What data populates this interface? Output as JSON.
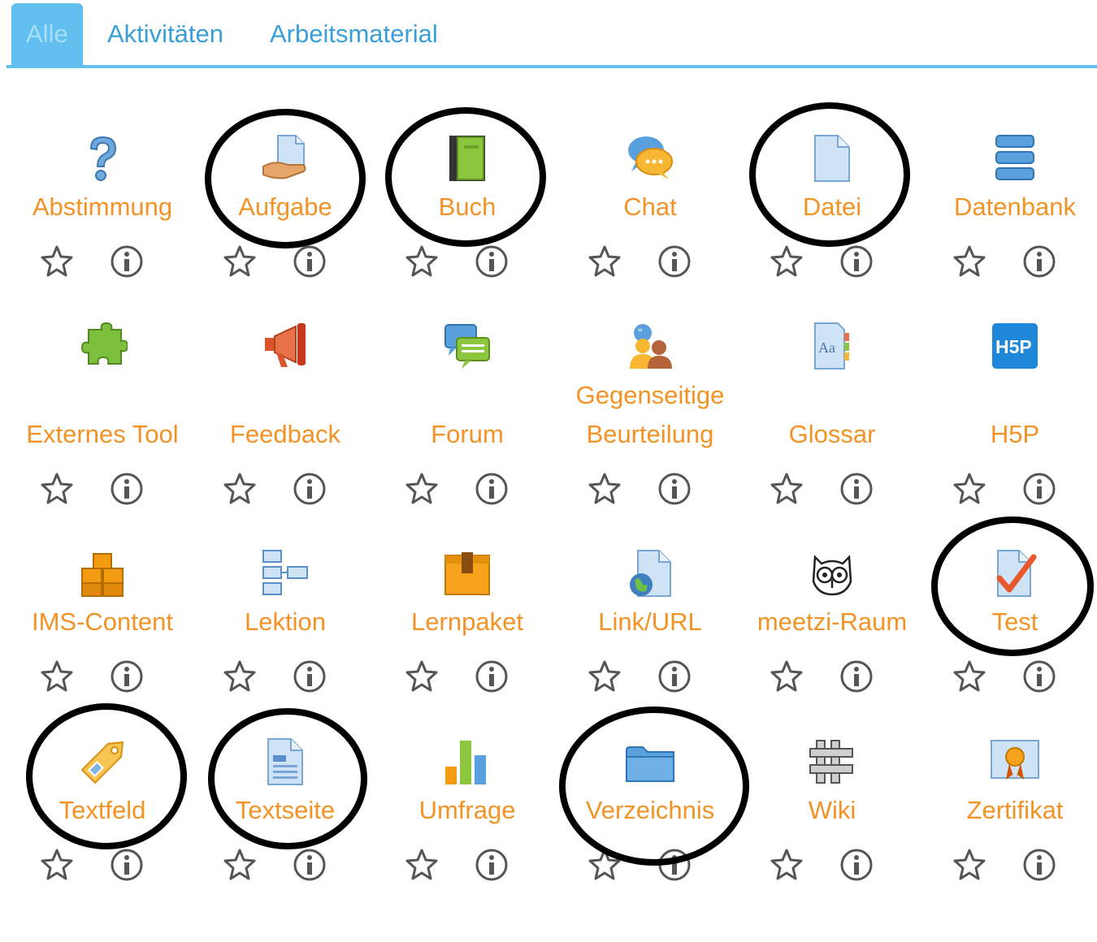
{
  "tabs": [
    {
      "label": "Alle",
      "active": true
    },
    {
      "label": "Aktivitäten",
      "active": false
    },
    {
      "label": "Arbeitsmaterial",
      "active": false
    }
  ],
  "colors": {
    "tab_active_bg": "#62bff0",
    "tab_text": "#3a9fd8",
    "module_label": "#f39326",
    "action_icon": "#555555"
  },
  "modules": [
    {
      "label": "Abstimmung",
      "icon": "question-icon"
    },
    {
      "label": "Aufgabe",
      "icon": "assignment-icon",
      "circled": true
    },
    {
      "label": "Buch",
      "icon": "book-icon",
      "circled": true
    },
    {
      "label": "Chat",
      "icon": "chat-bubble-icon"
    },
    {
      "label": "Datei",
      "icon": "file-icon",
      "circled": true
    },
    {
      "label": "Datenbank",
      "icon": "database-icon"
    },
    {
      "label": "Externes Tool",
      "icon": "puzzle-icon"
    },
    {
      "label": "Feedback",
      "icon": "megaphone-icon"
    },
    {
      "label": "Forum",
      "icon": "forum-icon"
    },
    {
      "label_lines": [
        "Gegenseitige",
        "Beurteilung"
      ],
      "icon": "workshop-icon"
    },
    {
      "label": "Glossar",
      "icon": "glossary-icon"
    },
    {
      "label": "H5P",
      "icon": "h5p-icon"
    },
    {
      "label": "IMS-Content",
      "icon": "ims-boxes-icon"
    },
    {
      "label": "Lektion",
      "icon": "lesson-icon"
    },
    {
      "label": "Lernpaket",
      "icon": "package-box-icon"
    },
    {
      "label": "Link/URL",
      "icon": "url-globe-icon"
    },
    {
      "label": "meetzi-Raum",
      "icon": "owl-icon"
    },
    {
      "label": "Test",
      "icon": "quiz-check-icon",
      "circled": true
    },
    {
      "label": "Textfeld",
      "icon": "label-tag-icon",
      "circled": true
    },
    {
      "label": "Textseite",
      "icon": "page-icon",
      "circled": true
    },
    {
      "label": "Umfrage",
      "icon": "bar-chart-icon"
    },
    {
      "label": "Verzeichnis",
      "icon": "folder-icon",
      "circled": true
    },
    {
      "label": "Wiki",
      "icon": "wiki-icon"
    },
    {
      "label": "Zertifikat",
      "icon": "certificate-icon"
    }
  ],
  "action_icons": {
    "favourite": "star-outline-icon",
    "info": "info-circle-icon"
  }
}
